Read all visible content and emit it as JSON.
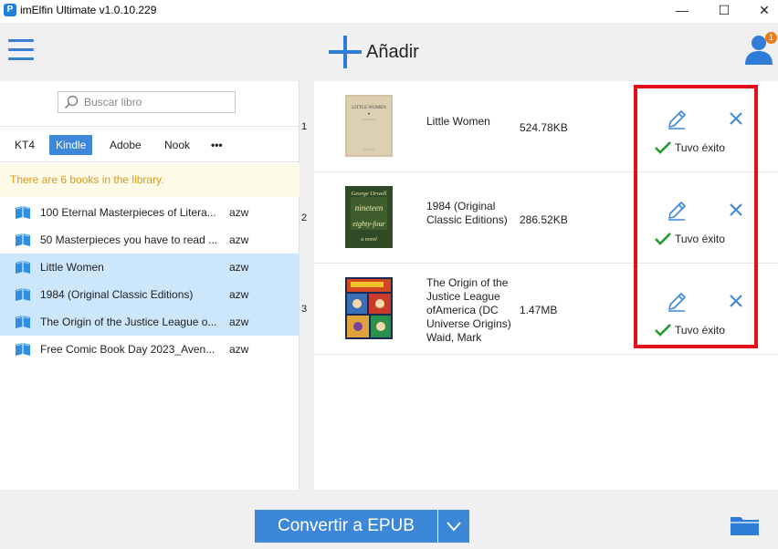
{
  "window": {
    "title": "imElfin Ultimate v1.0.10.229",
    "logo_letter": "P",
    "minimize": "—",
    "maximize": "☐",
    "close": "✕"
  },
  "header": {
    "add_label": "Añadir",
    "notification_count": "1"
  },
  "sidebar": {
    "search_placeholder": "Buscar libro",
    "tabs": [
      {
        "label": "KT4",
        "active": false
      },
      {
        "label": "Kindle",
        "active": true
      },
      {
        "label": "Adobe",
        "active": false
      },
      {
        "label": "Nook",
        "active": false
      },
      {
        "label": "•••",
        "active": false
      }
    ],
    "notice": "There are 6 books in the library.",
    "books": [
      {
        "title": "100 Eternal Masterpieces of Litera...",
        "format": "azw",
        "selected": false
      },
      {
        "title": "50 Masterpieces you have to read ...",
        "format": "azw",
        "selected": false
      },
      {
        "title": "Little Women",
        "format": "azw",
        "selected": true
      },
      {
        "title": "1984 (Original Classic Editions)",
        "format": "azw",
        "selected": true
      },
      {
        "title": "The Origin of the Justice League o...",
        "format": "azw",
        "selected": true
      },
      {
        "title": "Free Comic Book Day 2023_Aven...",
        "format": "azw",
        "selected": false
      }
    ]
  },
  "conversions": [
    {
      "index": "1",
      "title_lines": [
        "Little Women"
      ],
      "size": "524.78KB",
      "status": "Tuvo éxito",
      "cover": "little-women"
    },
    {
      "index": "2",
      "title_lines": [
        "1984 (Original",
        "Classic Editions)"
      ],
      "size": "286.52KB",
      "status": "Tuvo éxito",
      "cover": "1984"
    },
    {
      "index": "3",
      "title_lines": [
        "The Origin of the",
        "Justice League",
        "ofAmerica (DC",
        "Universe Origins)",
        "Waid, Mark"
      ],
      "size": "1.47MB",
      "status": "Tuvo éxito",
      "cover": "comic"
    }
  ],
  "cover_text": {
    "little_women": "LITTLE WOMEN",
    "orwell_author": "George Orwell",
    "orwell_l1": "nineteen",
    "orwell_l2": "eighty-four",
    "orwell_l3": "a novel"
  },
  "footer": {
    "convert_label": "Convertir a EPUB"
  },
  "colors": {
    "accent": "#3d87d8",
    "success": "#1f9c2a",
    "highlight": "#e3101b",
    "selected_row": "#cce6fb",
    "notice_text": "#d99a18"
  }
}
